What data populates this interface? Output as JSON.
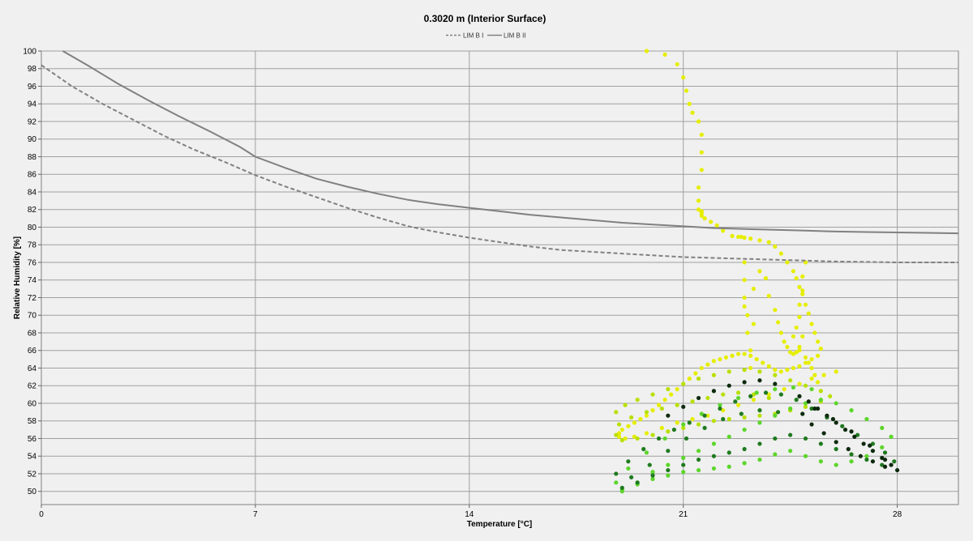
{
  "chart_data": {
    "type": "scatter",
    "title": "0.3020 m (Interior Surface)",
    "xlabel": "Temperature [°C]",
    "ylabel": "Relative Humidity [%]",
    "xlim": [
      0,
      30
    ],
    "ylim": [
      48.5,
      100
    ],
    "x_ticks": [
      "0",
      "7",
      "14",
      "21",
      "28"
    ],
    "x_tick_values": [
      0,
      7,
      14,
      21,
      28
    ],
    "y_ticks": [
      "50",
      "52",
      "54",
      "56",
      "58",
      "60",
      "62",
      "64",
      "66",
      "68",
      "70",
      "72",
      "74",
      "76",
      "78",
      "80",
      "82",
      "84",
      "86",
      "88",
      "90",
      "92",
      "94",
      "96",
      "98",
      "100"
    ],
    "y_tick_values": [
      50,
      52,
      54,
      56,
      58,
      60,
      62,
      64,
      66,
      68,
      70,
      72,
      74,
      76,
      78,
      80,
      82,
      84,
      86,
      88,
      90,
      92,
      94,
      96,
      98,
      100
    ],
    "grid": true,
    "legend_position": "top-center",
    "legend": [
      {
        "label": "LIM B I",
        "style": "dashed",
        "color": "#808080"
      },
      {
        "label": "LIM B II",
        "style": "solid",
        "color": "#808080"
      }
    ],
    "series": [
      {
        "name": "LIM B I",
        "kind": "line",
        "style": "dashed",
        "color": "#808080",
        "x": [
          0,
          1,
          2,
          3,
          4,
          5,
          6,
          7,
          8,
          9,
          10,
          11,
          12,
          13,
          14,
          15,
          16,
          17,
          18,
          19,
          20,
          21,
          22,
          23,
          24,
          25,
          26,
          27,
          28,
          29,
          30
        ],
        "y": [
          98.4,
          96.0,
          94.0,
          92.2,
          90.4,
          88.8,
          87.4,
          85.9,
          84.6,
          83.4,
          82.2,
          81.1,
          80.1,
          79.4,
          78.8,
          78.3,
          77.8,
          77.4,
          77.2,
          77.0,
          76.8,
          76.6,
          76.5,
          76.4,
          76.3,
          76.2,
          76.1,
          76.05,
          76.0,
          76.0,
          76.0
        ]
      },
      {
        "name": "LIM B II",
        "kind": "line",
        "style": "solid",
        "color": "#808080",
        "x": [
          0.7,
          1.5,
          2.5,
          3.5,
          4.5,
          5.5,
          6.5,
          7,
          8,
          9,
          10,
          11,
          12,
          13,
          14,
          15,
          16,
          17,
          18,
          19,
          20,
          21,
          22,
          23,
          24,
          25,
          26,
          27,
          28,
          29,
          30
        ],
        "y": [
          100.0,
          98.4,
          96.3,
          94.4,
          92.6,
          90.9,
          89.1,
          88.0,
          86.7,
          85.5,
          84.6,
          83.8,
          83.1,
          82.6,
          82.2,
          81.8,
          81.4,
          81.1,
          80.8,
          80.5,
          80.3,
          80.1,
          79.9,
          79.8,
          79.7,
          79.6,
          79.5,
          79.45,
          79.4,
          79.35,
          79.3
        ]
      },
      {
        "name": "",
        "kind": "points",
        "color": "#e6ee00",
        "x": [
          19.8,
          20.4,
          20.8,
          21.0,
          21.1,
          21.2,
          21.3,
          21.5,
          21.6,
          21.6,
          21.6,
          21.5,
          21.5,
          21.5,
          21.6,
          21.6,
          21.6,
          21.7,
          21.9,
          22.1,
          22.3,
          22.6,
          22.8,
          22.9,
          23.0,
          23.2,
          23.5,
          23.8,
          24.0,
          24.2,
          24.4,
          24.6,
          24.7,
          24.8,
          24.9,
          25.0,
          25.1,
          25.2,
          25.3,
          25.4,
          25.5,
          25.4,
          25.2,
          25.0,
          24.8,
          24.6,
          24.4,
          24.2,
          24.0,
          23.8,
          23.6,
          23.4,
          23.2,
          23.0,
          22.8,
          22.6,
          22.4,
          22.2,
          22.0,
          21.8,
          21.6,
          21.4,
          21.2,
          21.0,
          20.8,
          20.6,
          20.4,
          20.2,
          20.0,
          19.8,
          19.6,
          19.4,
          19.2,
          19.0,
          18.9,
          18.9,
          19.1,
          19.4,
          19.8,
          20.3,
          20.8,
          21.3,
          21.8,
          22.3,
          22.8,
          23.3,
          23.8,
          24.3,
          24.8,
          25.2,
          25.6,
          26.0,
          23.0,
          23.0,
          23.0,
          23.1,
          23.1,
          23.2,
          23.2,
          23.3,
          23.0,
          23.3,
          23.5,
          23.7,
          23.8,
          24.0,
          24.1,
          24.2,
          24.3,
          24.4,
          24.5,
          24.6,
          24.7,
          24.8,
          24.9,
          25.0,
          24.9,
          24.9,
          24.8,
          24.8,
          24.7,
          24.6,
          24.8,
          25.0,
          25.1,
          25.2,
          25.3,
          25.4
        ],
        "y": [
          100.0,
          99.6,
          98.5,
          97.0,
          95.5,
          94.0,
          93.0,
          92.0,
          90.5,
          88.5,
          86.5,
          84.5,
          83.0,
          82.0,
          81.8,
          81.6,
          81.3,
          81.0,
          80.6,
          80.2,
          79.6,
          79.0,
          78.9,
          78.9,
          78.8,
          78.7,
          78.5,
          78.3,
          77.8,
          77.0,
          76.0,
          75.0,
          74.2,
          73.2,
          72.4,
          71.2,
          70.2,
          69.0,
          68.0,
          67.0,
          66.2,
          65.4,
          65.0,
          64.6,
          64.2,
          64.0,
          63.8,
          63.6,
          63.8,
          64.2,
          64.6,
          65.0,
          65.4,
          65.6,
          65.6,
          65.4,
          65.2,
          65.0,
          64.8,
          64.4,
          64.0,
          63.4,
          62.8,
          62.2,
          61.6,
          61.0,
          60.4,
          59.8,
          59.2,
          58.6,
          58.2,
          57.8,
          57.4,
          57.0,
          56.6,
          56.2,
          56.0,
          56.2,
          56.6,
          57.2,
          57.8,
          58.2,
          58.6,
          59.2,
          59.8,
          60.4,
          61.0,
          61.6,
          62.2,
          62.8,
          63.2,
          63.6,
          76.0,
          74.0,
          72.0,
          70.0,
          68.0,
          66.0,
          64.0,
          69.0,
          71.0,
          73.0,
          75.0,
          74.2,
          72.2,
          70.6,
          69.2,
          68.0,
          67.0,
          66.4,
          65.8,
          65.6,
          65.8,
          66.4,
          67.6,
          76.0,
          74.4,
          72.8,
          71.2,
          69.8,
          68.6,
          67.6,
          66.0,
          65.2,
          64.6,
          64.0,
          63.2,
          62.4
        ]
      },
      {
        "name": "",
        "kind": "points",
        "color": "#b8e000",
        "x": [
          18.8,
          19.1,
          19.5,
          20.0,
          20.5,
          21.0,
          21.5,
          22.0,
          22.5,
          23.0,
          23.5,
          24.0,
          24.5,
          25.0,
          25.5,
          25.8,
          25.5,
          25.0,
          24.5,
          24.0,
          23.5,
          23.0,
          22.5,
          22.0,
          21.5,
          21.0,
          20.5,
          20.0,
          19.5,
          19.0,
          18.8,
          18.9,
          19.3,
          19.8,
          20.3,
          20.8,
          21.3,
          21.8,
          22.3,
          22.8,
          23.3,
          23.8
        ],
        "y": [
          59.0,
          59.8,
          60.4,
          61.0,
          61.6,
          62.2,
          62.8,
          63.2,
          63.6,
          63.8,
          63.6,
          63.2,
          62.6,
          62.0,
          61.4,
          60.8,
          60.2,
          59.6,
          59.2,
          58.8,
          58.6,
          58.4,
          58.2,
          58.0,
          57.6,
          57.2,
          56.8,
          56.4,
          56.0,
          55.8,
          56.4,
          57.6,
          58.4,
          59.0,
          59.4,
          59.8,
          60.2,
          60.6,
          61.0,
          61.2,
          61.0,
          60.6
        ]
      },
      {
        "name": "",
        "kind": "points",
        "color": "#5cd62a",
        "x": [
          19.0,
          19.5,
          20.0,
          20.5,
          21.0,
          21.5,
          22.0,
          22.5,
          23.0,
          23.5,
          24.0,
          24.5,
          25.0,
          25.5,
          26.0,
          26.5,
          27.0,
          27.5,
          27.8,
          27.5,
          27.0,
          26.5,
          26.0,
          25.5,
          25.0,
          24.5,
          24.0,
          23.5,
          23.0,
          22.5,
          22.0,
          21.5,
          21.0,
          20.5,
          20.0,
          19.5,
          19.0,
          18.8,
          19.2,
          19.8,
          20.4,
          21.0,
          21.6,
          22.2,
          22.8,
          23.4,
          24.0,
          24.6,
          25.2
        ],
        "y": [
          50.0,
          51.0,
          52.2,
          53.0,
          53.8,
          54.6,
          55.4,
          56.2,
          57.0,
          57.8,
          58.6,
          59.4,
          60.0,
          60.4,
          60.0,
          59.2,
          58.2,
          57.2,
          56.2,
          55.0,
          54.0,
          53.4,
          53.0,
          53.4,
          54.0,
          54.6,
          54.2,
          53.6,
          53.2,
          52.8,
          52.6,
          52.4,
          52.2,
          51.8,
          51.4,
          50.8,
          50.2,
          51.0,
          52.6,
          54.4,
          56.0,
          57.6,
          58.8,
          59.8,
          60.6,
          61.2,
          61.6,
          61.8,
          61.6
        ]
      },
      {
        "name": "",
        "kind": "points",
        "color": "#1f7a1f",
        "x": [
          18.8,
          19.2,
          19.7,
          20.2,
          20.7,
          21.2,
          21.7,
          22.2,
          22.7,
          23.2,
          23.7,
          24.2,
          24.7,
          25.2,
          25.7,
          26.2,
          26.7,
          27.2,
          27.6,
          27.9,
          27.5,
          27.0,
          26.5,
          26.0,
          25.5,
          25.0,
          24.5,
          24.0,
          23.5,
          23.0,
          22.5,
          22.0,
          21.5,
          21.0,
          20.5,
          20.0,
          19.5,
          19.0,
          19.3,
          19.9,
          20.5,
          21.1,
          21.7,
          22.3,
          22.9,
          23.5,
          24.1
        ],
        "y": [
          52.0,
          53.4,
          54.8,
          56.0,
          57.0,
          57.8,
          58.6,
          59.4,
          60.2,
          60.8,
          61.2,
          61.0,
          60.4,
          59.4,
          58.4,
          57.4,
          56.4,
          55.4,
          54.4,
          53.4,
          53.0,
          53.6,
          54.2,
          54.8,
          55.4,
          56.0,
          56.4,
          56.0,
          55.4,
          54.8,
          54.4,
          54.0,
          53.6,
          53.0,
          52.4,
          51.8,
          51.0,
          50.4,
          51.6,
          53.0,
          54.6,
          56.0,
          57.2,
          58.2,
          58.8,
          59.2,
          59.0
        ]
      },
      {
        "name": "",
        "kind": "points",
        "color": "#0d2a0d",
        "x": [
          24.8,
          25.1,
          25.4,
          25.7,
          26.0,
          26.3,
          26.6,
          26.9,
          27.2,
          27.5,
          27.8,
          28.0,
          27.6,
          27.2,
          26.8,
          26.4,
          26.0,
          25.6,
          25.2,
          24.9,
          25.3,
          25.9,
          26.5,
          27.1,
          27.6,
          20.5,
          21.0,
          21.5,
          22.0,
          22.5,
          23.0,
          23.5,
          24.0
        ],
        "y": [
          60.8,
          60.2,
          59.4,
          58.6,
          57.8,
          57.0,
          56.2,
          55.4,
          54.6,
          53.8,
          53.0,
          52.4,
          52.8,
          53.4,
          54.0,
          54.8,
          55.6,
          56.6,
          57.6,
          58.8,
          59.4,
          58.2,
          56.8,
          55.2,
          53.6,
          58.6,
          59.6,
          60.6,
          61.4,
          62.0,
          62.4,
          62.6,
          62.2
        ]
      }
    ]
  }
}
